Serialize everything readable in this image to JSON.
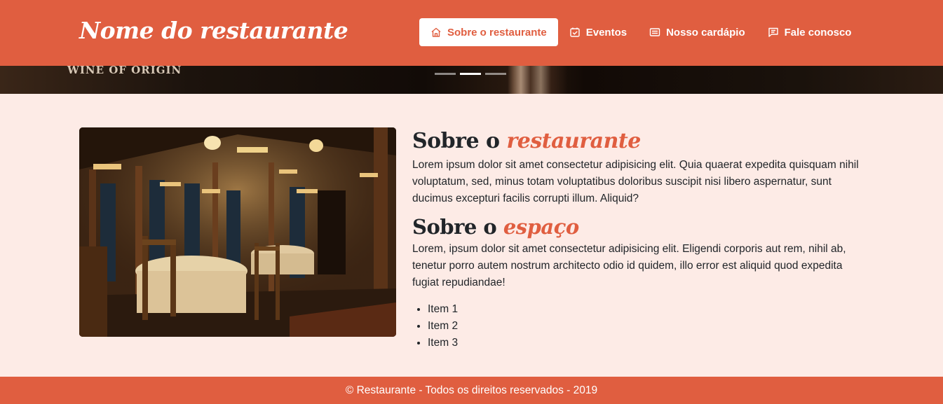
{
  "brand": "Nome do restaurante",
  "nav": [
    {
      "label": "Sobre o restaurante",
      "icon": "home-icon",
      "active": true
    },
    {
      "label": "Eventos",
      "icon": "calendar-check-icon",
      "active": false
    },
    {
      "label": "Nosso cardápio",
      "icon": "menu-card-icon",
      "active": false
    },
    {
      "label": "Fale conosco",
      "icon": "chat-icon",
      "active": false
    }
  ],
  "hero": {
    "label": "WINE OF ORIGIN",
    "slide_count": 3,
    "active_slide": 2
  },
  "about": {
    "title_prefix": "Sobre o",
    "title_accent": "restaurante",
    "text": "Lorem ipsum dolor sit amet consectetur adipisicing elit. Quia quaerat expedita quisquam nihil voluptatum, sed, minus totam voluptatibus doloribus suscipit nisi libero aspernatur, sunt ducimus excepturi facilis corrupti illum. Aliquid?"
  },
  "space": {
    "title_prefix": "Sobre o",
    "title_accent": "espaço",
    "text": "Lorem, ipsum dolor sit amet consectetur adipisicing elit. Eligendi corporis aut rem, nihil ab, tenetur porro autem nostrum architecto odio id quidem, illo error est aliquid quod expedita fugiat repudiandae!",
    "items": [
      "Item 1",
      "Item 2",
      "Item 3"
    ]
  },
  "footer": "© Restaurante - Todos os direitos reservados - 2019",
  "colors": {
    "primary": "#e05e40",
    "background": "#fdebe6",
    "text": "#212529"
  }
}
